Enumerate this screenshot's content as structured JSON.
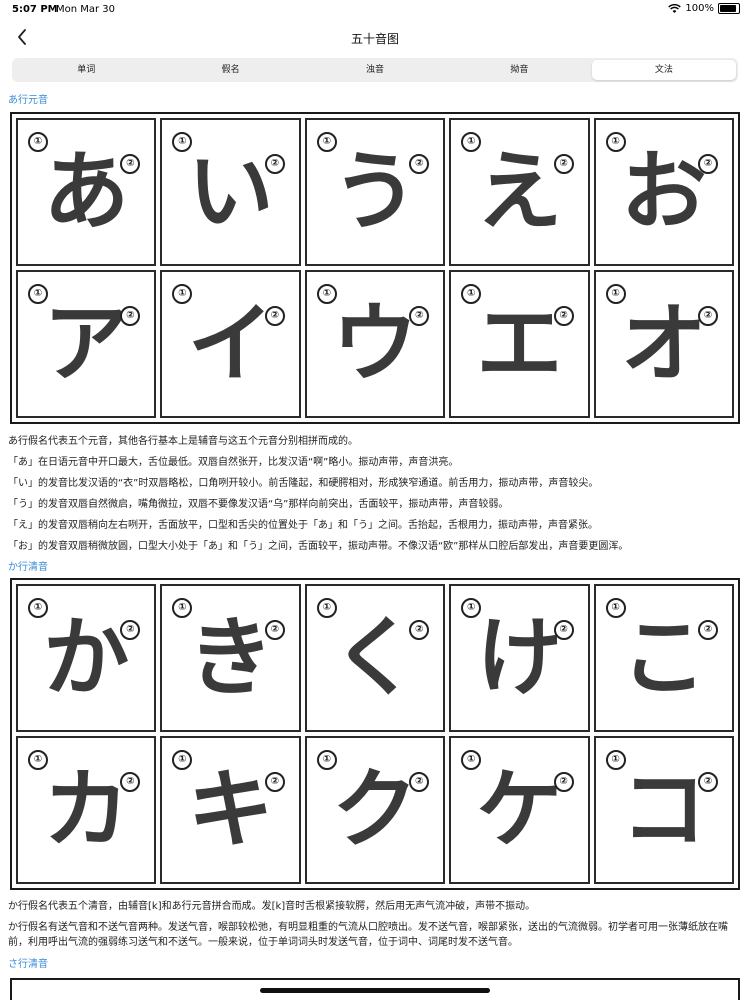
{
  "status_bar": {
    "time": "5:07 PM",
    "date": "Mon Mar 30",
    "battery": "100%",
    "battery_level": 1.0
  },
  "nav": {
    "title": "五十音图"
  },
  "tabs": [
    {
      "label": "单词",
      "active": false
    },
    {
      "label": "假名",
      "active": false
    },
    {
      "label": "浊音",
      "active": false
    },
    {
      "label": "拗音",
      "active": false
    },
    {
      "label": "文法",
      "active": true
    }
  ],
  "sections": [
    {
      "heading": "あ行元音",
      "chars": [
        "あ",
        "い",
        "う",
        "え",
        "お",
        "ア",
        "イ",
        "ウ",
        "エ",
        "オ"
      ],
      "paragraphs": [
        "あ行假名代表五个元音，其他各行基本上是辅音与这五个元音分别相拼而成的。",
        "「あ」在日语元音中开口最大，舌位最低。双唇自然张开，比发汉语“啊”略小。振动声带，声音洪亮。",
        "「い」的发音比发汉语的“衣”时双唇略松，口角咧开较小。前舌隆起，和硬腭相对，形成狭窄通道。前舌用力，振动声带，声音较尖。",
        "「う」的发音双唇自然微启，嘴角微拉，双唇不要像发汉语“乌”那样向前突出，舌面较平，振动声带，声音较弱。",
        "「え」的发音双唇稍向左右咧开，舌面放平，口型和舌尖的位置处于「あ」和「う」之间。舌抬起，舌根用力，振动声带，声音紧张。",
        "「お」的发音双唇稍微放圆，口型大小处于「あ」和「う」之间，舌面较平，振动声带。不像汉语“欧”那样从口腔后部发出，声音要更圆浑。"
      ]
    },
    {
      "heading": "か行清音",
      "chars": [
        "か",
        "き",
        "く",
        "け",
        "こ",
        "カ",
        "キ",
        "ク",
        "ケ",
        "コ"
      ],
      "paragraphs": [
        "か行假名代表五个清音，由辅音[k]和あ行元音拼合而成。发[k]音时舌根紧接软腭，然后用无声气流冲破，声带不振动。",
        "か行假名有送气音和不送气音两种。发送气音，喉部较松弛，有明显粗重的气流从口腔喷出。发不送气音，喉部紧张，送出的气流微弱。初学者可用一张薄纸放在嘴前，利用呼出气流的强弱练习送气和不送气。一般来说，位于单词词头时发送气音，位于词中、词尾时发不送气音。"
      ]
    },
    {
      "heading": "さ行清音"
    }
  ],
  "stroke_numbers": [
    "①",
    "②"
  ]
}
